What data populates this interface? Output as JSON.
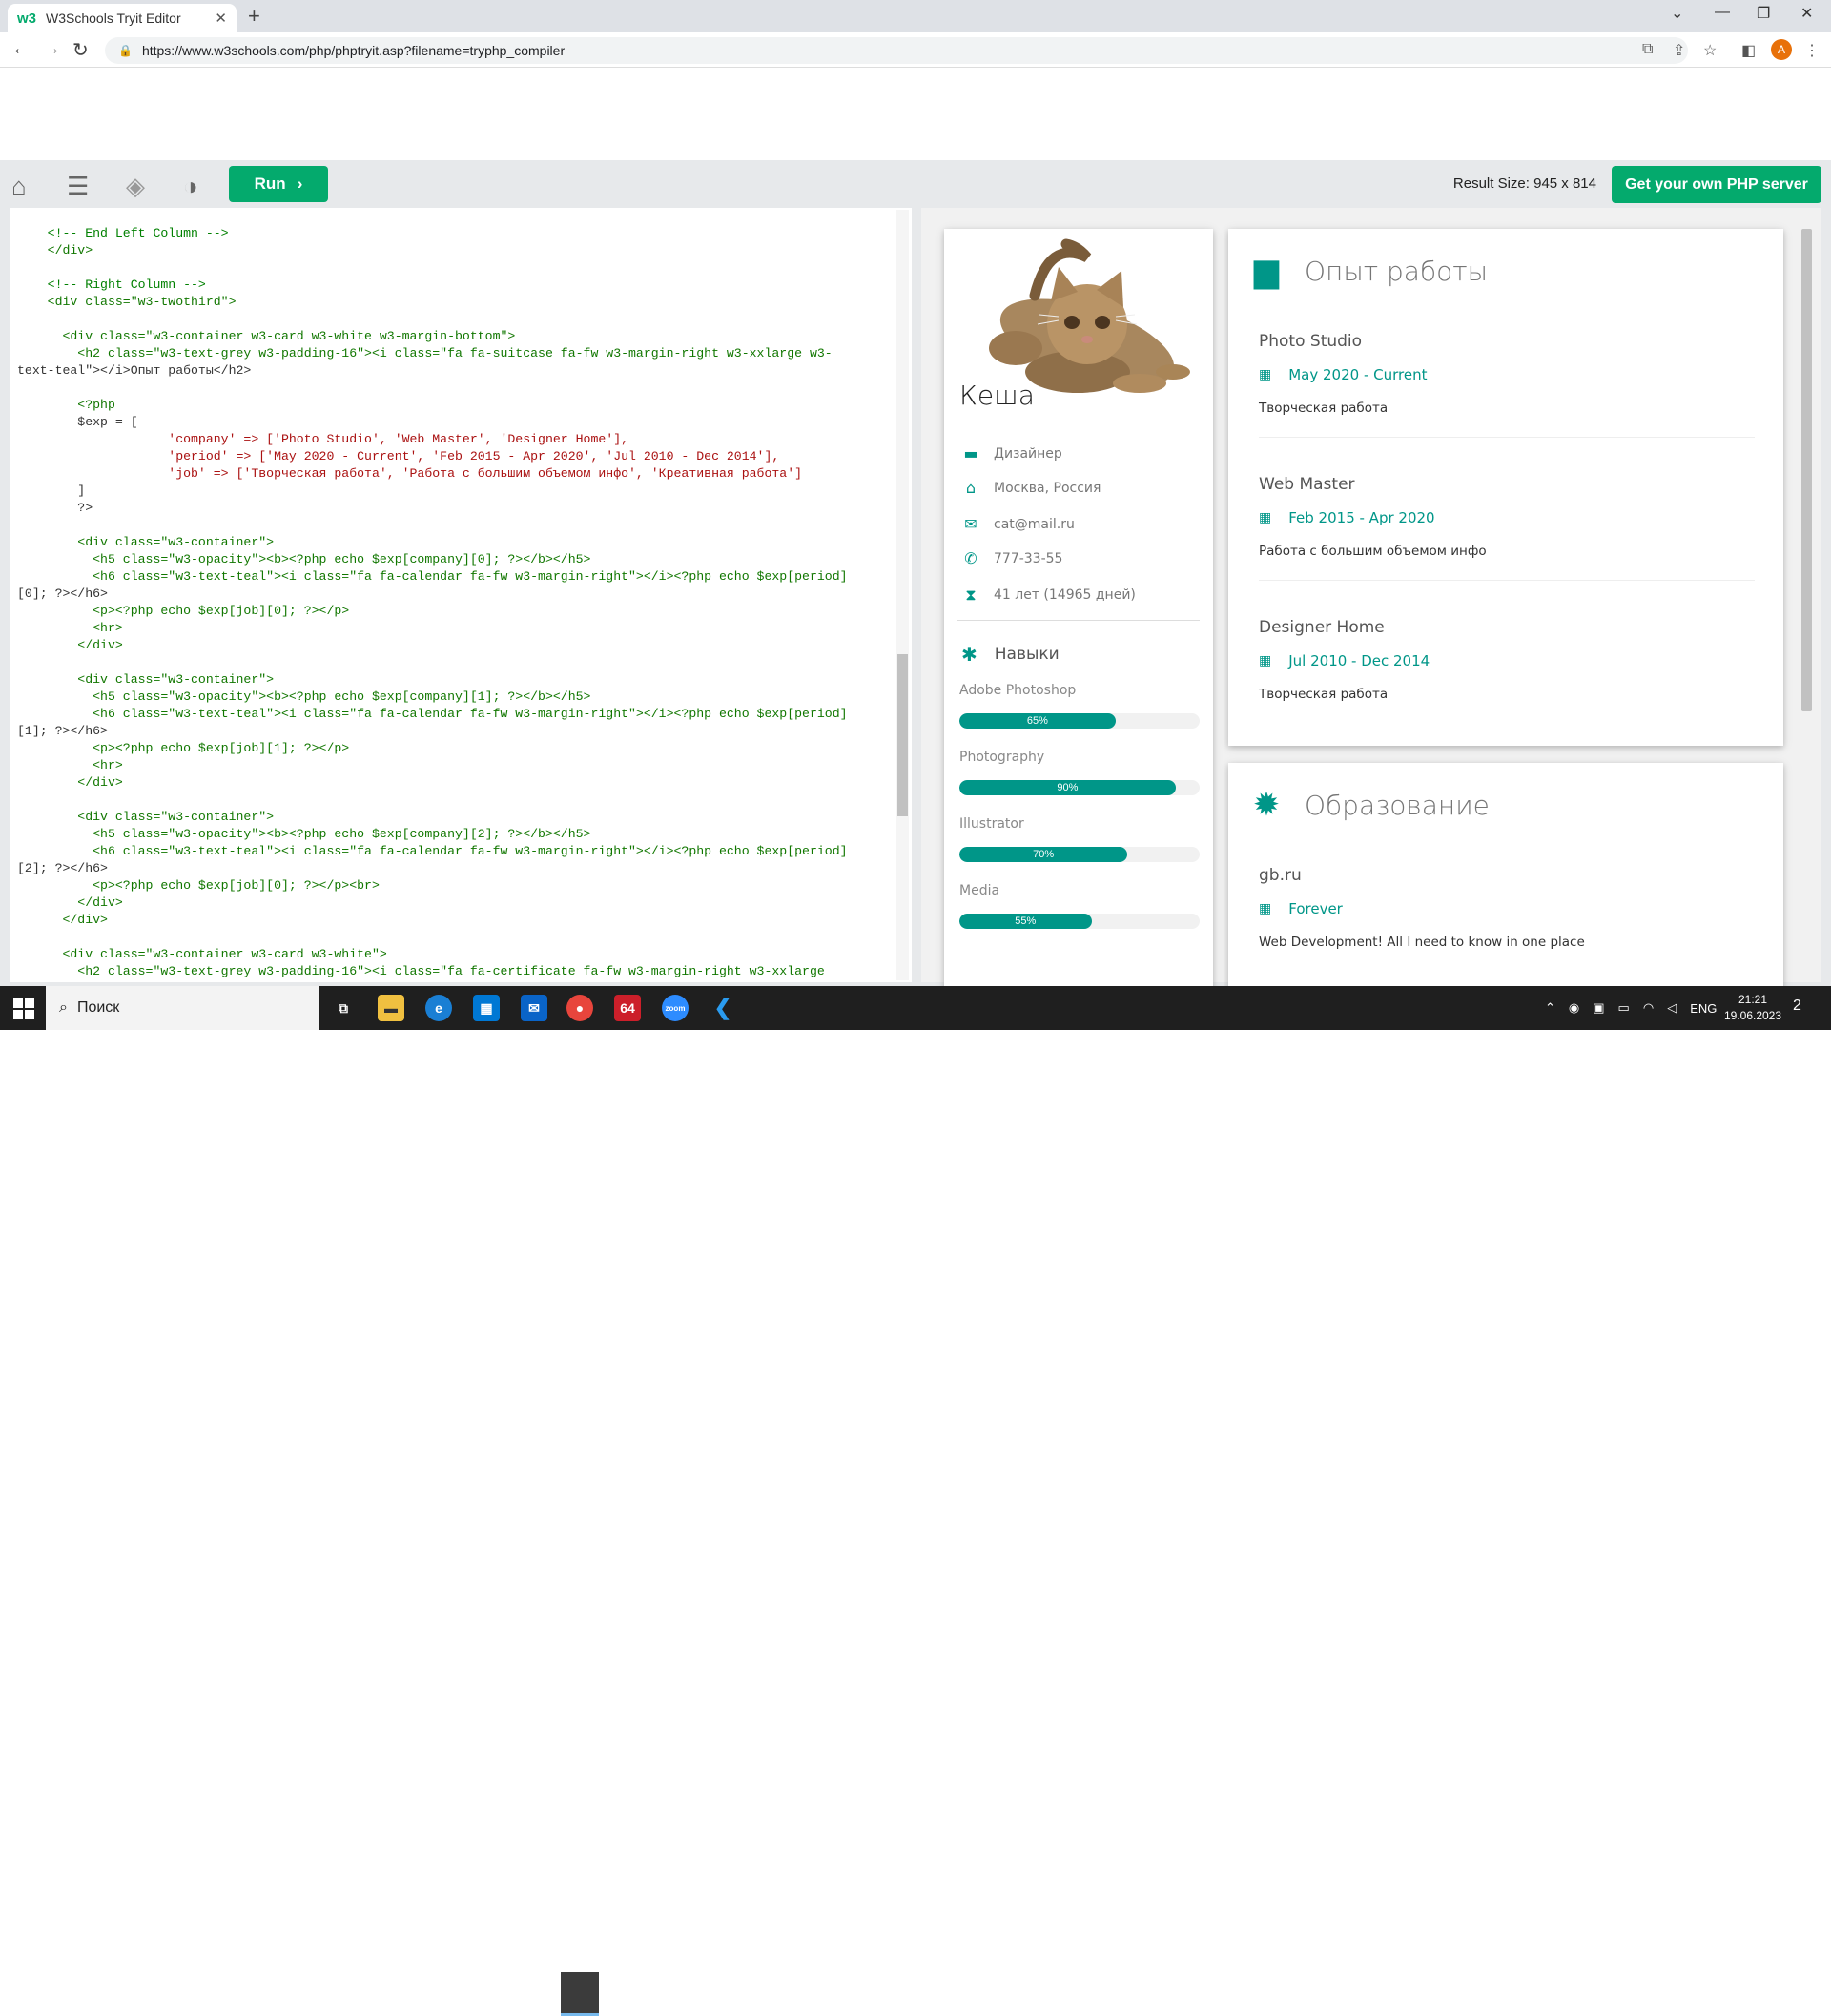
{
  "browser": {
    "tab_title": "W3Schools Tryit Editor",
    "favicon": "w3",
    "url": "https://www.w3schools.com/php/phptryit.asp?filename=tryphp_compiler",
    "profile_initial": "A"
  },
  "toolbar": {
    "run_label": "Run",
    "result_size": "Result Size: 945 x 814",
    "get_server_label": "Get your own PHP server"
  },
  "code_lines": [
    "    <!-- End Left Column -->",
    "    </div>",
    "",
    "    <!-- Right Column -->",
    "    <div class=\"w3-twothird\">",
    "",
    "      <div class=\"w3-container w3-card w3-white w3-margin-bottom\">",
    "        <h2 class=\"w3-text-grey w3-padding-16\"><i class=\"fa fa-suitcase fa-fw w3-margin-right w3-xxlarge w3-",
    "text-teal\"></i>Опыт работы</h2>",
    "",
    "        <?php",
    "        $exp = [",
    "                    'company' => ['Photo Studio', 'Web Master', 'Designer Home'],",
    "                    'period' => ['May 2020 - Current', 'Feb 2015 - Apr 2020', 'Jul 2010 - Dec 2014'],",
    "                    'job' => ['Творческая работа', 'Работа с большим объемом инфо', 'Креативная работа']",
    "        ]",
    "        ?>",
    "",
    "        <div class=\"w3-container\">",
    "          <h5 class=\"w3-opacity\"><b><?php echo $exp[company][0]; ?></b></h5>",
    "          <h6 class=\"w3-text-teal\"><i class=\"fa fa-calendar fa-fw w3-margin-right\"></i><?php echo $exp[period]",
    "[0]; ?></h6>",
    "          <p><?php echo $exp[job][0]; ?></p>",
    "          <hr>",
    "        </div>",
    "",
    "        <div class=\"w3-container\">",
    "          <h5 class=\"w3-opacity\"><b><?php echo $exp[company][1]; ?></b></h5>",
    "          <h6 class=\"w3-text-teal\"><i class=\"fa fa-calendar fa-fw w3-margin-right\"></i><?php echo $exp[period]",
    "[1]; ?></h6>",
    "          <p><?php echo $exp[job][1]; ?></p>",
    "          <hr>",
    "        </div>",
    "",
    "        <div class=\"w3-container\">",
    "          <h5 class=\"w3-opacity\"><b><?php echo $exp[company][2]; ?></b></h5>",
    "          <h6 class=\"w3-text-teal\"><i class=\"fa fa-calendar fa-fw w3-margin-right\"></i><?php echo $exp[period]",
    "[2]; ?></h6>",
    "          <p><?php echo $exp[job][0]; ?></p><br>",
    "        </div>",
    "      </div>",
    "",
    "      <div class=\"w3-container w3-card w3-white\">",
    "        <h2 class=\"w3-text-grey w3-padding-16\"><i class=\"fa fa-certificate fa-fw w3-margin-right w3-xxlarge"
  ],
  "profile": {
    "name": "Кеша",
    "info": [
      {
        "icon": "briefcase-icon",
        "glyph": "▬",
        "text": "Дизайнер"
      },
      {
        "icon": "home-icon",
        "glyph": "⌂",
        "text": "Москва, Россия"
      },
      {
        "icon": "envelope-icon",
        "glyph": "✉",
        "text": "cat@mail.ru"
      },
      {
        "icon": "phone-icon",
        "glyph": "✆",
        "text": "777-33-55"
      },
      {
        "icon": "hourglass-icon",
        "glyph": "⧗",
        "text": "41 лет (14965 дней)"
      }
    ],
    "skills_title": "Навыки",
    "skills": [
      {
        "name": "Adobe Photoshop",
        "percent": 65,
        "label": "65%"
      },
      {
        "name": "Photography",
        "percent": 90,
        "label": "90%"
      },
      {
        "name": "Illustrator",
        "percent": 70,
        "label": "70%"
      },
      {
        "name": "Media",
        "percent": 55,
        "label": "55%"
      }
    ]
  },
  "experience": {
    "title": "Опыт работы",
    "jobs": [
      {
        "company": "Photo Studio",
        "period": "May 2020 - Current",
        "desc": "Творческая работа"
      },
      {
        "company": "Web Master",
        "period": "Feb 2015 - Apr 2020",
        "desc": "Работа с большим объемом инфо"
      },
      {
        "company": "Designer Home",
        "period": "Jul 2010 - Dec 2014",
        "desc": "Творческая работа"
      }
    ]
  },
  "education": {
    "title": "Образование",
    "items": [
      {
        "school": "gb.ru",
        "period": "Forever",
        "desc": "Web Development! All I need to know in one place"
      }
    ]
  },
  "taskbar": {
    "search_placeholder": "Поиск",
    "language": "ENG",
    "time": "21:21",
    "date": "19.06.2023",
    "notifications": "2"
  },
  "colors": {
    "teal": "#009688",
    "w3_green": "#04aa6d"
  }
}
